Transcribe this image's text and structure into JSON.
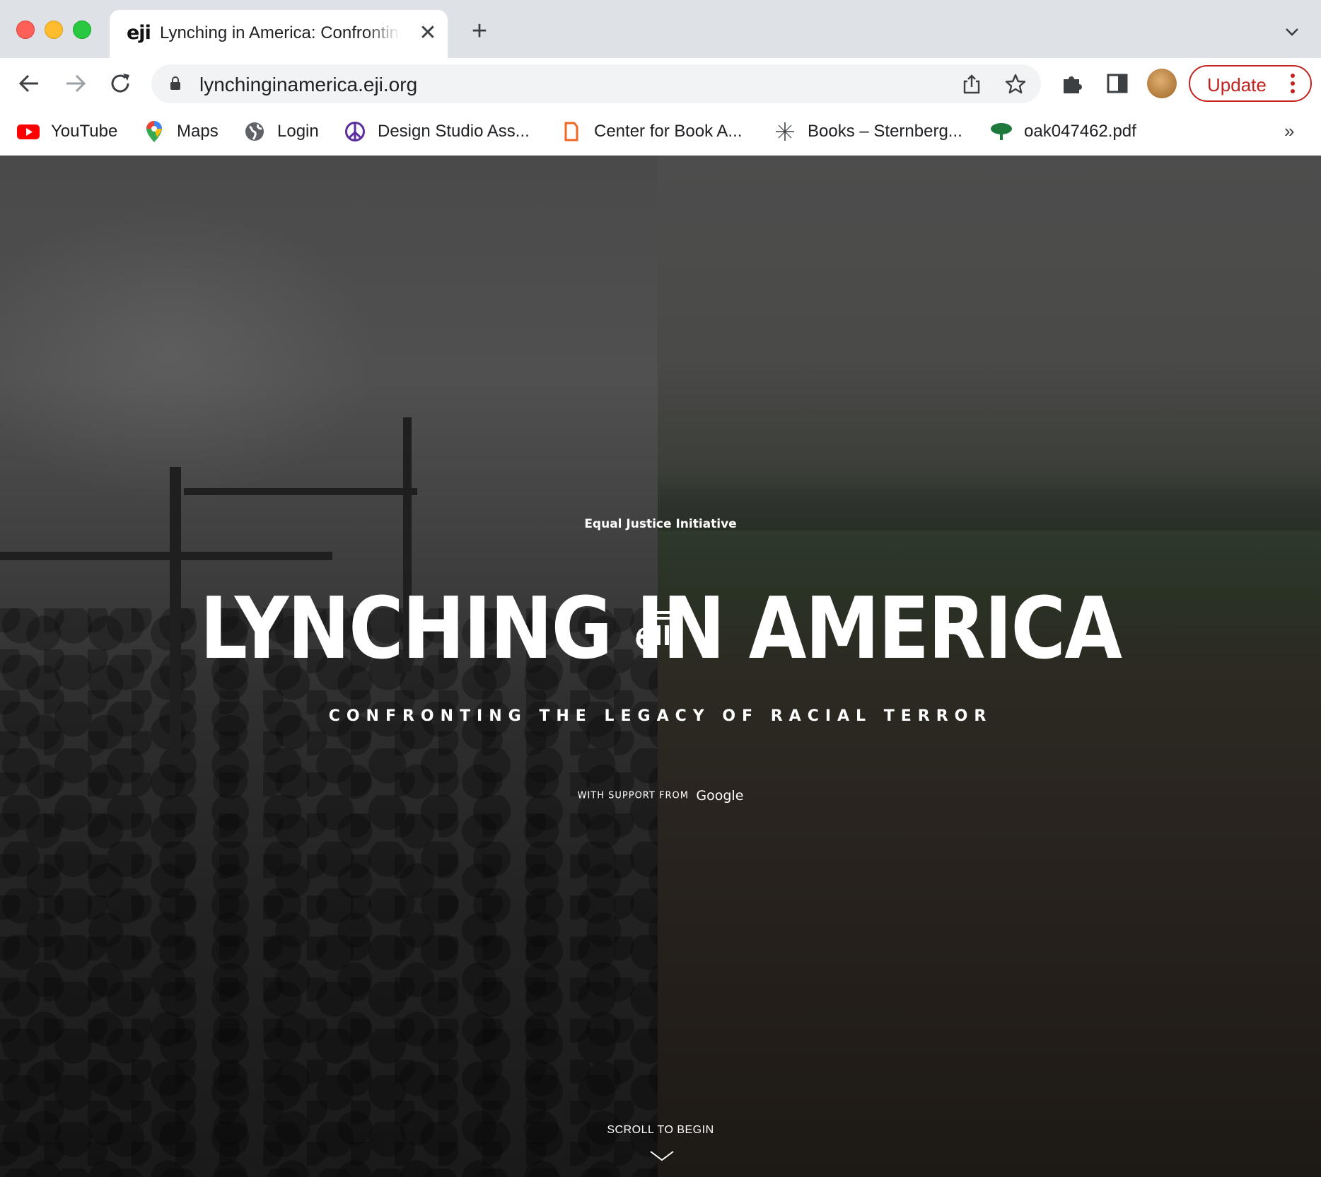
{
  "browser": {
    "tab": {
      "title": "Lynching in America: Confronting the Legacy of Racial Terror",
      "favicon_text": "eji"
    },
    "address": {
      "url": "lynchinginamerica.eji.org"
    },
    "update_label": "Update",
    "bookmarks": [
      {
        "label": "YouTube",
        "icon": "youtube-icon"
      },
      {
        "label": "Maps",
        "icon": "maps-pin-icon"
      },
      {
        "label": "Login",
        "icon": "globe-icon"
      },
      {
        "label": "Design Studio Ass...",
        "icon": "peace-icon"
      },
      {
        "label": "Center for Book A...",
        "icon": "book-arts-icon"
      },
      {
        "label": "Books – Sternberg...",
        "icon": "star-burst-icon"
      },
      {
        "label": "oak047462.pdf",
        "icon": "tree-icon"
      }
    ],
    "more_bookmarks": "»"
  },
  "hero": {
    "org_name": "Equal Justice Initiative",
    "title": "LYNCHING IN AMERICA",
    "subtitle": "CONFRONTING THE LEGACY OF RACIAL TERROR",
    "support_label": "WITH SUPPORT FROM",
    "support_brand": "Google",
    "scroll_label": "SCROLL TO BEGIN"
  },
  "colors": {
    "update_red": "#c5221f",
    "tab_strip": "#dee1e6",
    "omnibox": "#f1f3f4"
  }
}
